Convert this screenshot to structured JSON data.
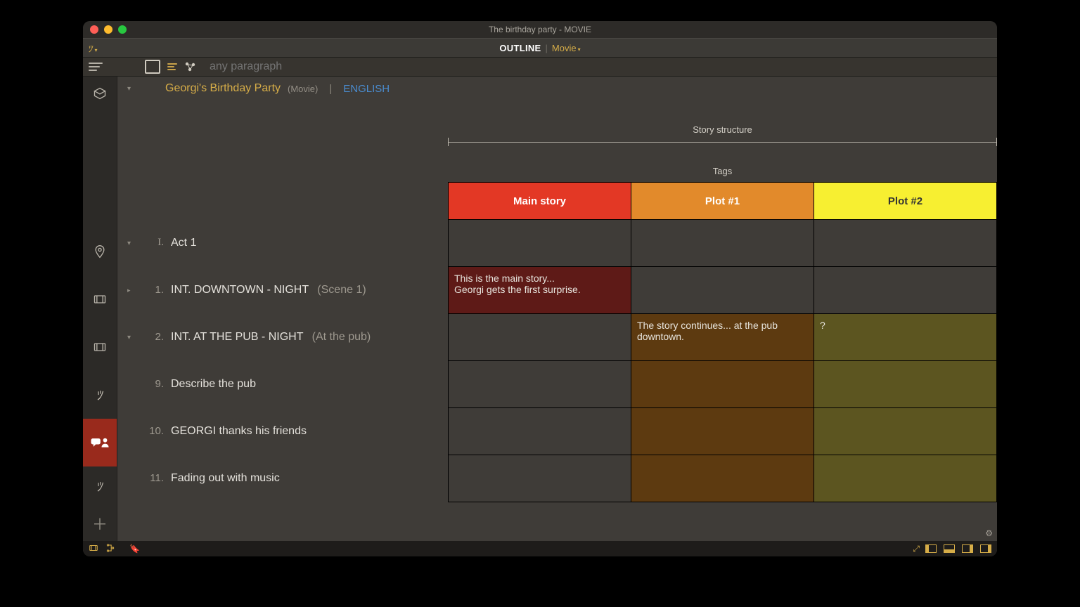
{
  "window_title": "The birthday party - MOVIE",
  "topnav": {
    "outline": "OUTLINE",
    "mode": "Movie"
  },
  "subbar": {
    "search_placeholder": "any paragraph"
  },
  "doc": {
    "title": "Georgi's Birthday Party",
    "type": "(Movie)",
    "language": "ENGLISH"
  },
  "outline": [
    {
      "num": "I.",
      "text": "Act 1",
      "annot": "",
      "chev": "down"
    },
    {
      "num": "1.",
      "text": "INT.  DOWNTOWN - NIGHT",
      "annot": "(Scene 1)",
      "chev": "right"
    },
    {
      "num": "2.",
      "text": "INT.  AT THE PUB - NIGHT",
      "annot": "(At the pub)",
      "chev": "down"
    },
    {
      "num": "9.",
      "text": "Describe the pub",
      "annot": "",
      "chev": ""
    },
    {
      "num": "10.",
      "text": "GEORGI thanks his friends",
      "annot": "",
      "chev": ""
    },
    {
      "num": "11.",
      "text": "Fading out with music",
      "annot": "",
      "chev": ""
    }
  ],
  "structure_label": "Story structure",
  "tags_label": "Tags",
  "columns": {
    "c1": "Main story",
    "c2": "Plot #1",
    "c3": "Plot #2"
  },
  "cells": {
    "r1c1": "This is the main story...\nGeorgi gets the first surprise.",
    "r2c2": "The story continues... at the pub downtown.",
    "r2c3": "?"
  }
}
